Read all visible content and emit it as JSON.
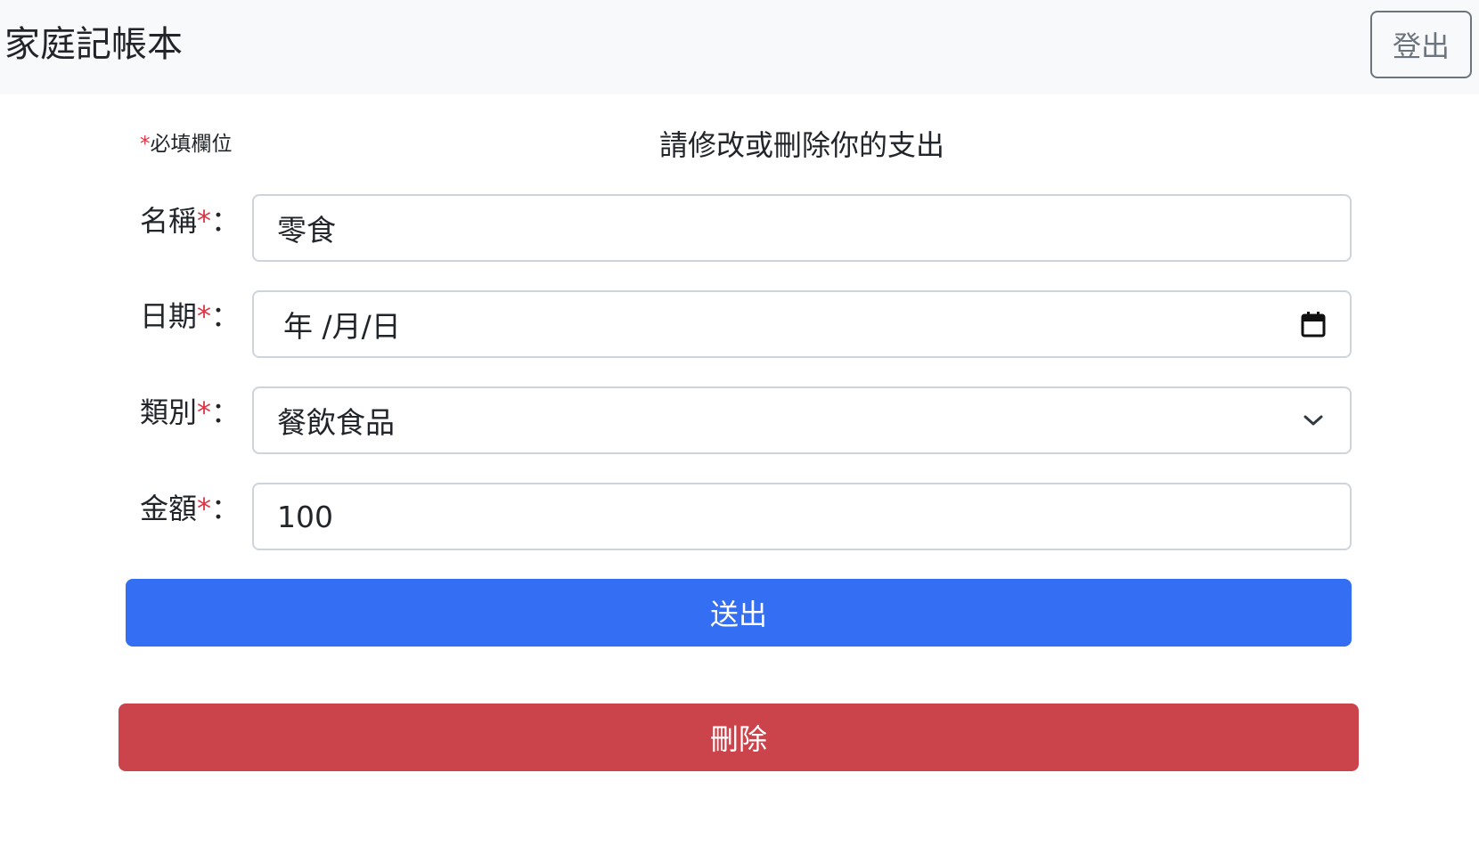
{
  "navbar": {
    "brand": "家庭記帳本",
    "logout_label": "登出"
  },
  "form": {
    "required_star": "*",
    "required_note": "必填欄位",
    "title": "請修改或刪除你的支出",
    "colon": "：",
    "fields": [
      {
        "label": "名稱",
        "value": "零食"
      },
      {
        "label": "日期",
        "value": "年 /月/日",
        "icon": "calendar-icon"
      },
      {
        "label": "類別",
        "value": "餐飲食品",
        "icon": "chevron-down-icon"
      },
      {
        "label": "金額",
        "value": "100"
      }
    ],
    "submit_label": "送出",
    "delete_label": "刪除"
  },
  "colors": {
    "primary": "#336ef3",
    "danger": "#cc444b",
    "required": "#dc3545",
    "navbar_bg": "#f8f9fa",
    "border": "#ced4da"
  }
}
